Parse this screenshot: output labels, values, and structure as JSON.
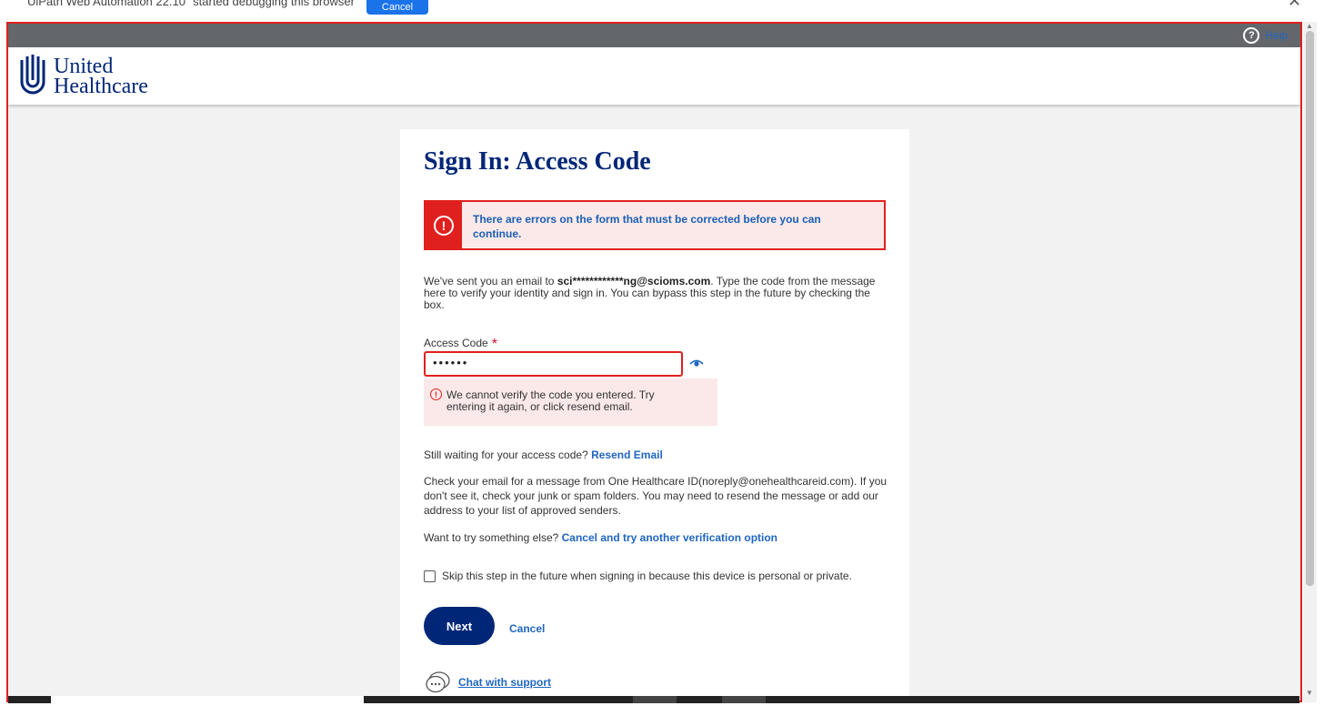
{
  "debug_bar": {
    "message": "UiPath Web Automation 22.10\" started debugging this browser",
    "cancel_label": "Cancel",
    "close_glyph": "✕"
  },
  "help": {
    "label": "Help",
    "icon": "?"
  },
  "logo": {
    "line1": "United",
    "line2": "Healthcare"
  },
  "page": {
    "title": "Sign In: Access Code",
    "alert_icon": "!",
    "alert_text": "There are errors on the form that must be corrected before you can continue.",
    "intro_pre": "We've sent you an email to ",
    "intro_email": "sci************ng@scioms.com",
    "intro_post": ". Type the code from the message here to verify your identity and sign in. You can bypass this step in the future by checking the box.",
    "access_label": "Access Code",
    "required_mark": "*",
    "access_value": "••••••",
    "field_error_icon": "!",
    "field_error": "We cannot verify the code you entered. Try entering it again, or click resend email.",
    "waiting_text": "Still waiting for your access code?",
    "resend_link": "Resend Email",
    "check_email_text": "Check your email for a message from One Healthcare ID(noreply@onehealthcareid.com). If you don't see it, check your junk or spam folders. You may need to resend the message or add our address to your list of approved senders.",
    "try_else_text": "Want to try something else?",
    "try_else_link": "Cancel and try another verification option",
    "skip_label": "Skip this step in the future when signing in because this device is personal or private.",
    "skip_checked": false,
    "next_label": "Next",
    "cancel_label": "Cancel",
    "chat_label": "Chat with support"
  },
  "colors": {
    "brand_navy": "#002677",
    "link_blue": "#1f66c1",
    "error_red": "#e0201e",
    "error_bg": "#fbe9e9"
  }
}
